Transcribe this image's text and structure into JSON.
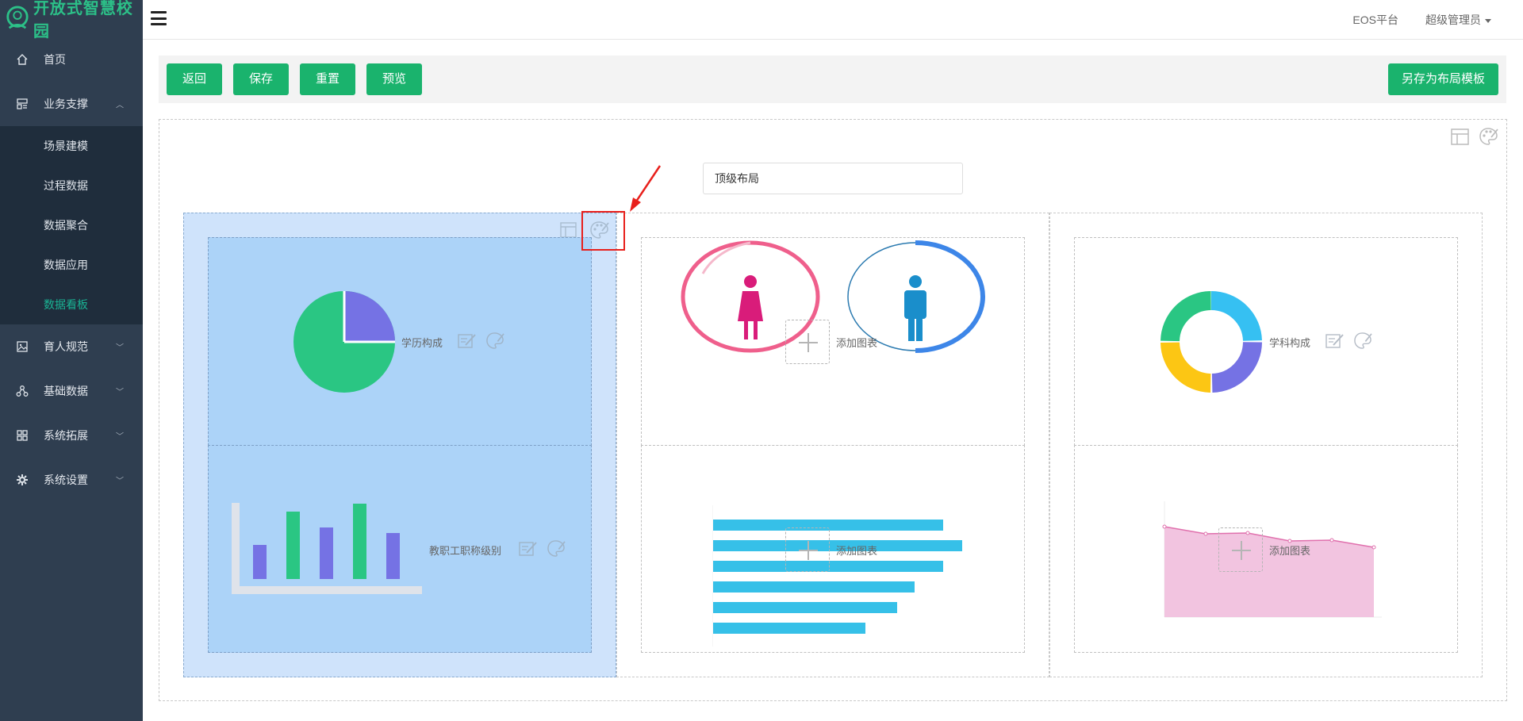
{
  "app": {
    "logo_text": "开放式智慧校园"
  },
  "sidebar": {
    "items": [
      {
        "label": "首页",
        "icon": "home-icon"
      },
      {
        "label": "业务支撑",
        "icon": "dashboard-icon",
        "expanded": true
      },
      {
        "label": "育人规范",
        "icon": "image-icon"
      },
      {
        "label": "基础数据",
        "icon": "sitemap-icon"
      },
      {
        "label": "系统拓展",
        "icon": "apps-icon"
      },
      {
        "label": "系统设置",
        "icon": "gear-icon"
      }
    ],
    "subitems": [
      {
        "label": "场景建模"
      },
      {
        "label": "过程数据"
      },
      {
        "label": "数据聚合"
      },
      {
        "label": "数据应用"
      },
      {
        "label": "数据看板",
        "active": true
      }
    ]
  },
  "header": {
    "platform": "EOS平台",
    "user": "超级管理员"
  },
  "toolbar": {
    "back_label": "返回",
    "save_label": "保存",
    "reset_label": "重置",
    "preview_label": "预览",
    "save_template_label": "另存为布局模板"
  },
  "layout": {
    "name_value": "顶级布局"
  },
  "cells": {
    "c1_top_label": "学历构成",
    "c1_bottom_label": "教职工职称级别",
    "c2_top_label": "添加图表",
    "c2_bottom_label": "添加图表",
    "c3_top_label": "学科构成",
    "c3_bottom_label": "添加图表"
  },
  "colors": {
    "accent": "#1ab36d",
    "sidebar_bg": "#2f3e50",
    "submenu_bg": "#1f2d3c",
    "active_text": "#1ab394",
    "selected_col": "#cfe3fb",
    "selected_cell": "#acd3f8",
    "highlight": "#e8201c"
  }
}
